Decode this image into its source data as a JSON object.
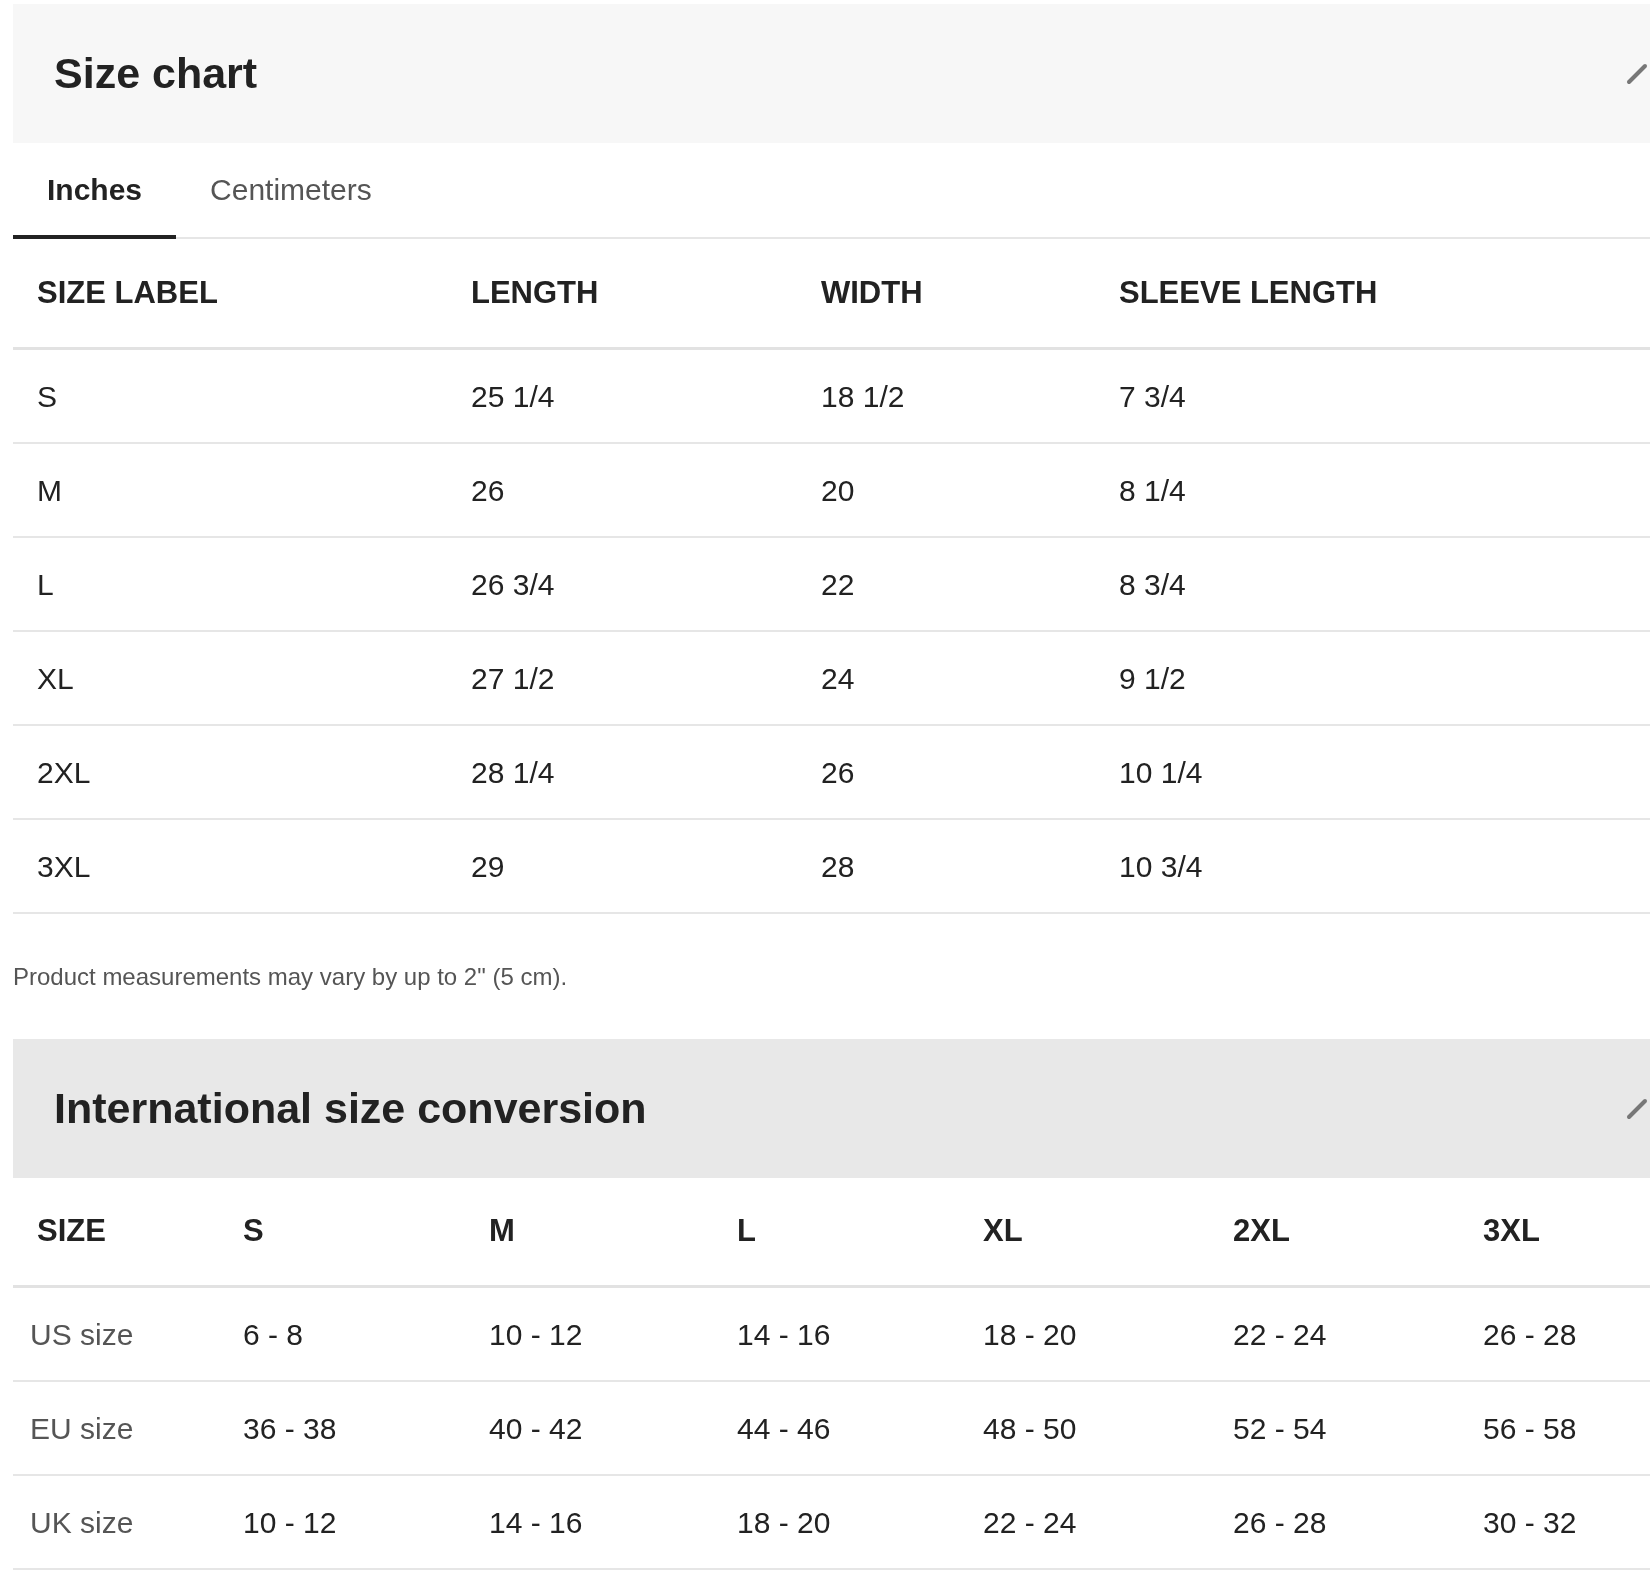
{
  "size_chart": {
    "title": "Size chart",
    "tabs": [
      {
        "label": "Inches",
        "selected": true
      },
      {
        "label": "Centimeters",
        "selected": false
      }
    ],
    "columns": [
      "SIZE LABEL",
      "LENGTH",
      "WIDTH",
      "SLEEVE LENGTH"
    ],
    "rows": [
      [
        "S",
        "25 1/4",
        "18 1/2",
        "7 3/4"
      ],
      [
        "M",
        "26",
        "20",
        "8 1/4"
      ],
      [
        "L",
        "26 3/4",
        "22",
        "8 3/4"
      ],
      [
        "XL",
        "27 1/2",
        "24",
        "9 1/2"
      ],
      [
        "2XL",
        "28 1/4",
        "26",
        "10 1/4"
      ],
      [
        "3XL",
        "29",
        "28",
        "10 3/4"
      ]
    ],
    "note": "Product measurements may vary by up to 2\" (5 cm)."
  },
  "conversion": {
    "title": "International size conversion",
    "columns": [
      "SIZE",
      "S",
      "M",
      "L",
      "XL",
      "2XL",
      "3XL"
    ],
    "rows": [
      [
        "US size",
        "6 - 8",
        "10 - 12",
        "14 - 16",
        "18 - 20",
        "22 - 24",
        "26 - 28"
      ],
      [
        "EU size",
        "36 - 38",
        "40 - 42",
        "44 - 46",
        "48 - 50",
        "52 - 54",
        "56 - 58"
      ],
      [
        "UK size",
        "10 - 12",
        "14 - 16",
        "18 - 20",
        "22 - 24",
        "26 - 28",
        "30 - 32"
      ]
    ]
  }
}
